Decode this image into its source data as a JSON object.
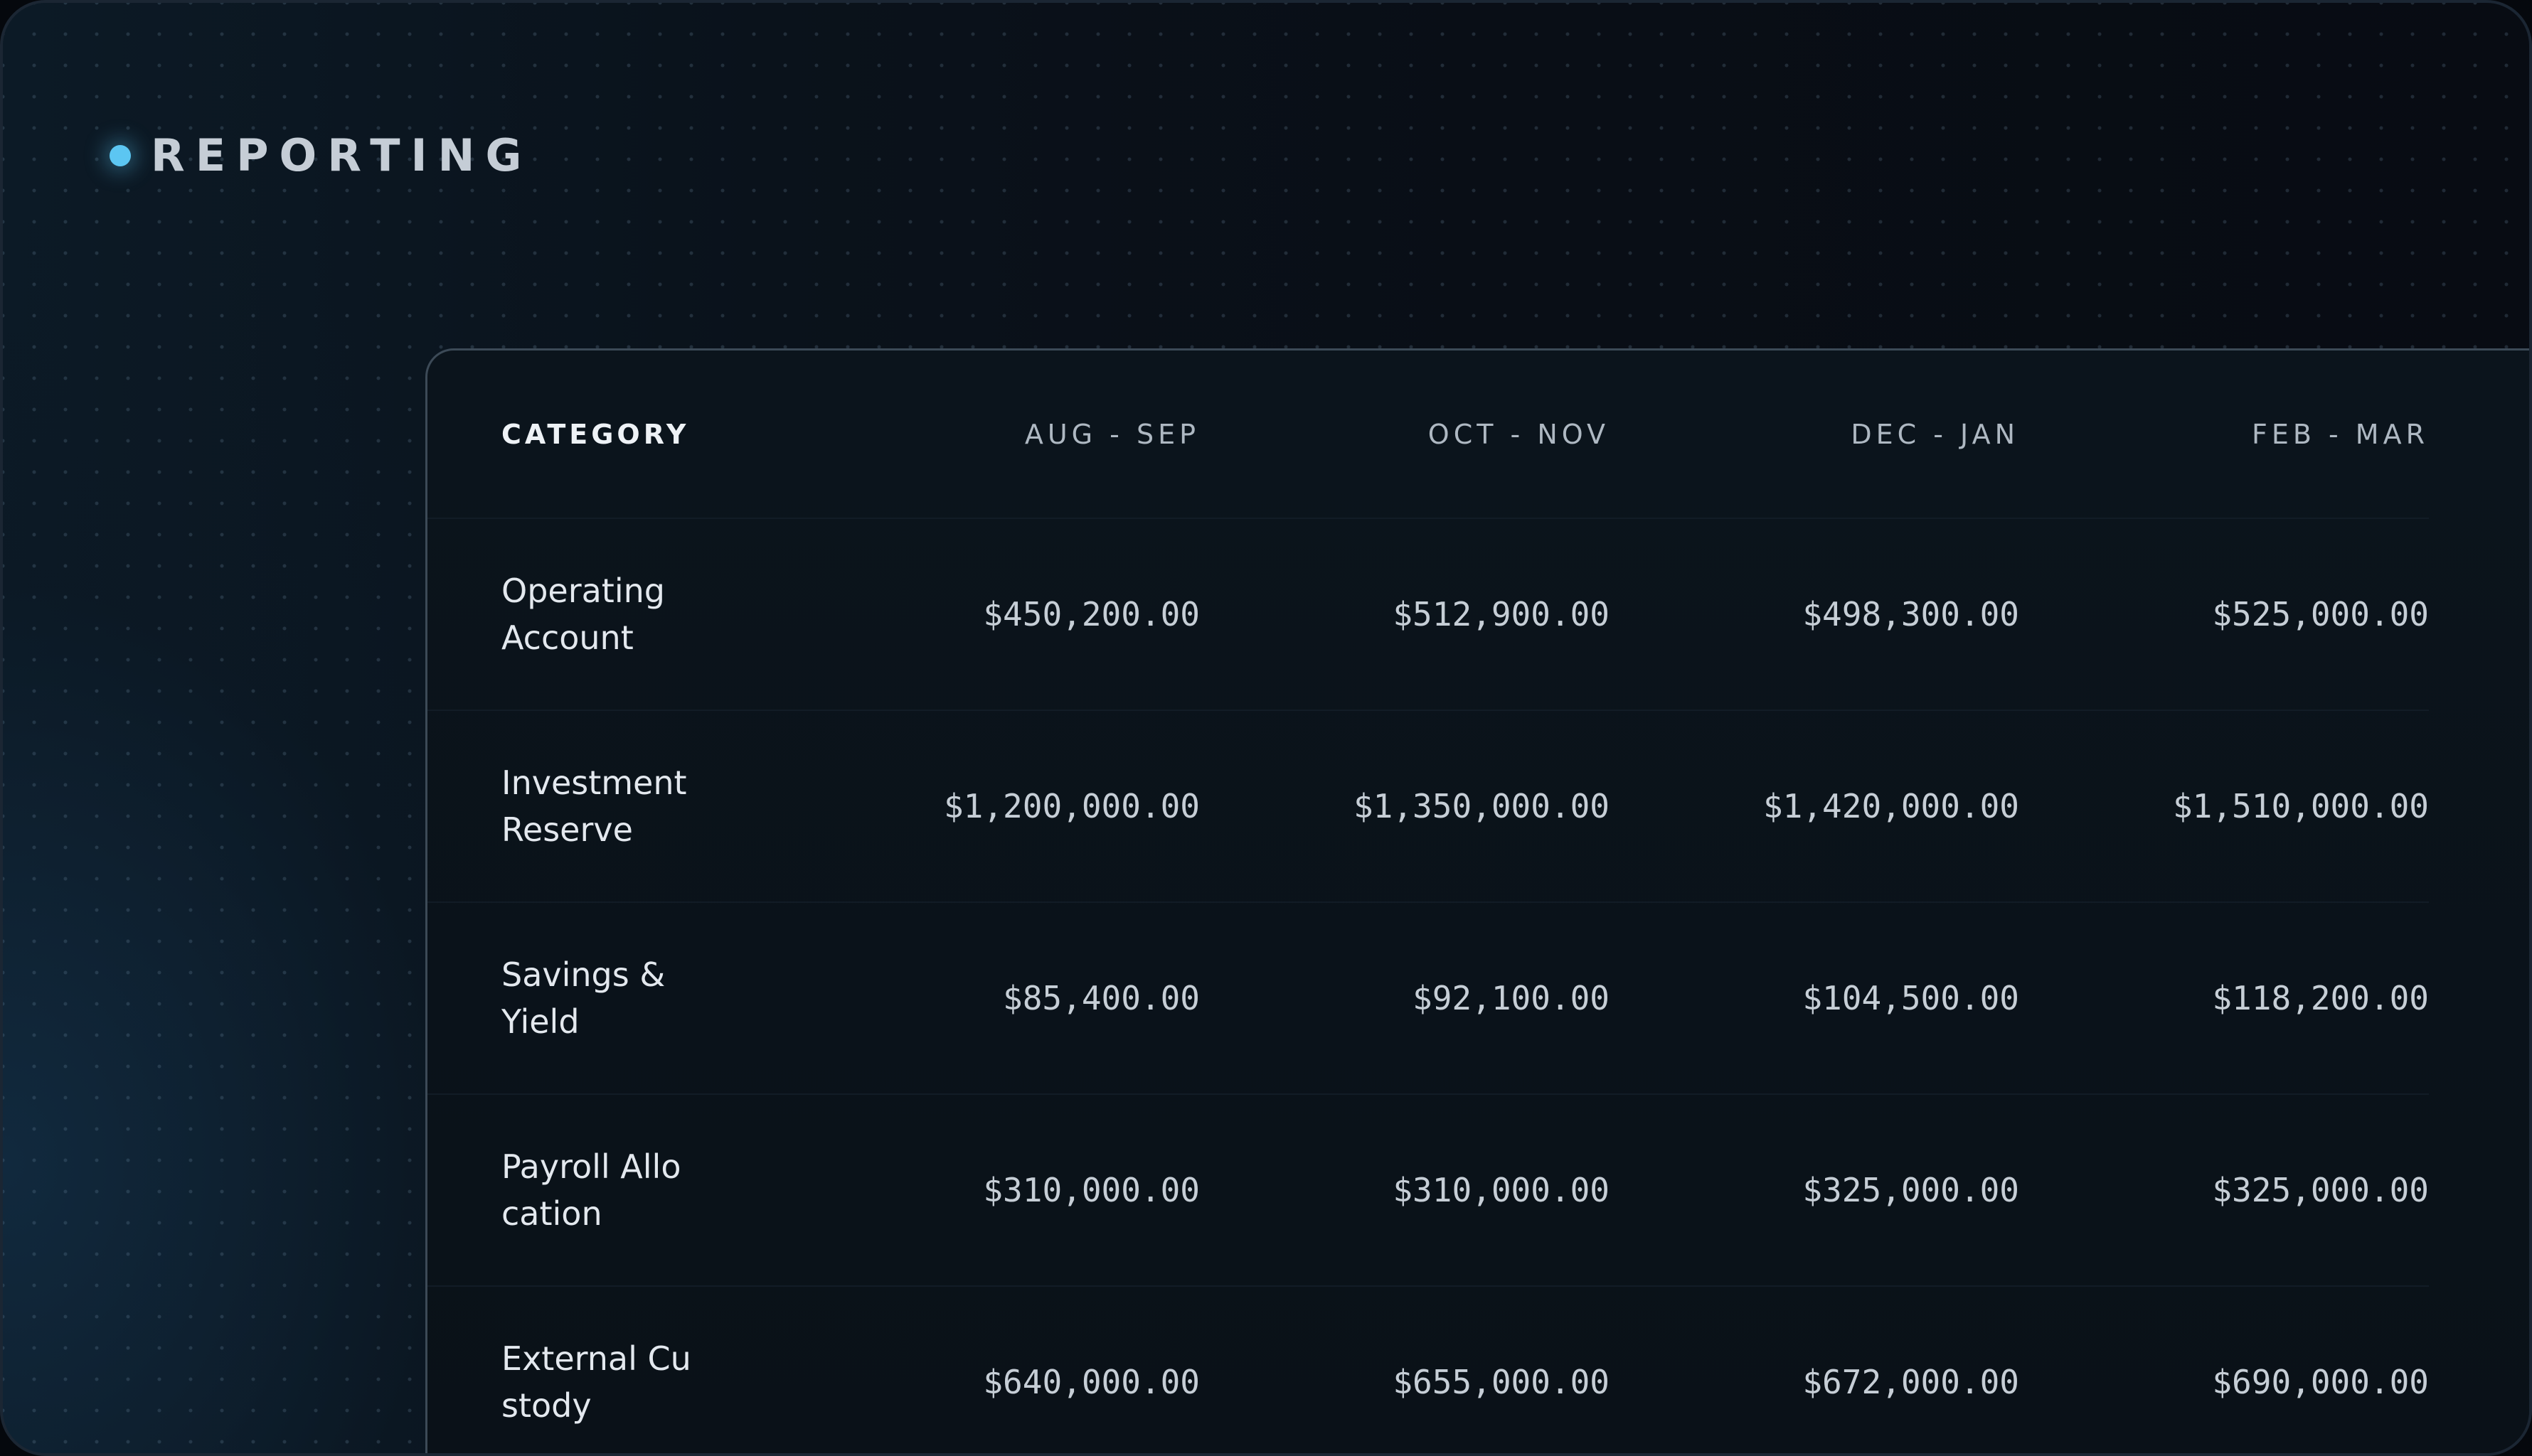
{
  "header": {
    "title": "REPORTING"
  },
  "colors": {
    "accent": "#5cc6f2",
    "background": "#080c13",
    "panel": "#0b141c"
  },
  "table": {
    "columns": [
      "CATEGORY",
      "AUG - SEP",
      "OCT - NOV",
      "DEC - JAN",
      "FEB - MAR"
    ],
    "rows": [
      {
        "category": "Operating Account",
        "values": [
          "$450,200.00",
          "$512,900.00",
          "$498,300.00",
          "$525,000.00"
        ]
      },
      {
        "category": "Investment Reserve",
        "values": [
          "$1,200,000.00",
          "$1,350,000.00",
          "$1,420,000.00",
          "$1,510,000.00"
        ]
      },
      {
        "category": "Savings & Yield",
        "values": [
          "$85,400.00",
          "$92,100.00",
          "$104,500.00",
          "$118,200.00"
        ]
      },
      {
        "category": "Payroll Allocation",
        "values": [
          "$310,000.00",
          "$310,000.00",
          "$325,000.00",
          "$325,000.00"
        ]
      },
      {
        "category": "External Custody",
        "values": [
          "$640,000.00",
          "$655,000.00",
          "$672,000.00",
          "$690,000.00"
        ]
      }
    ]
  }
}
